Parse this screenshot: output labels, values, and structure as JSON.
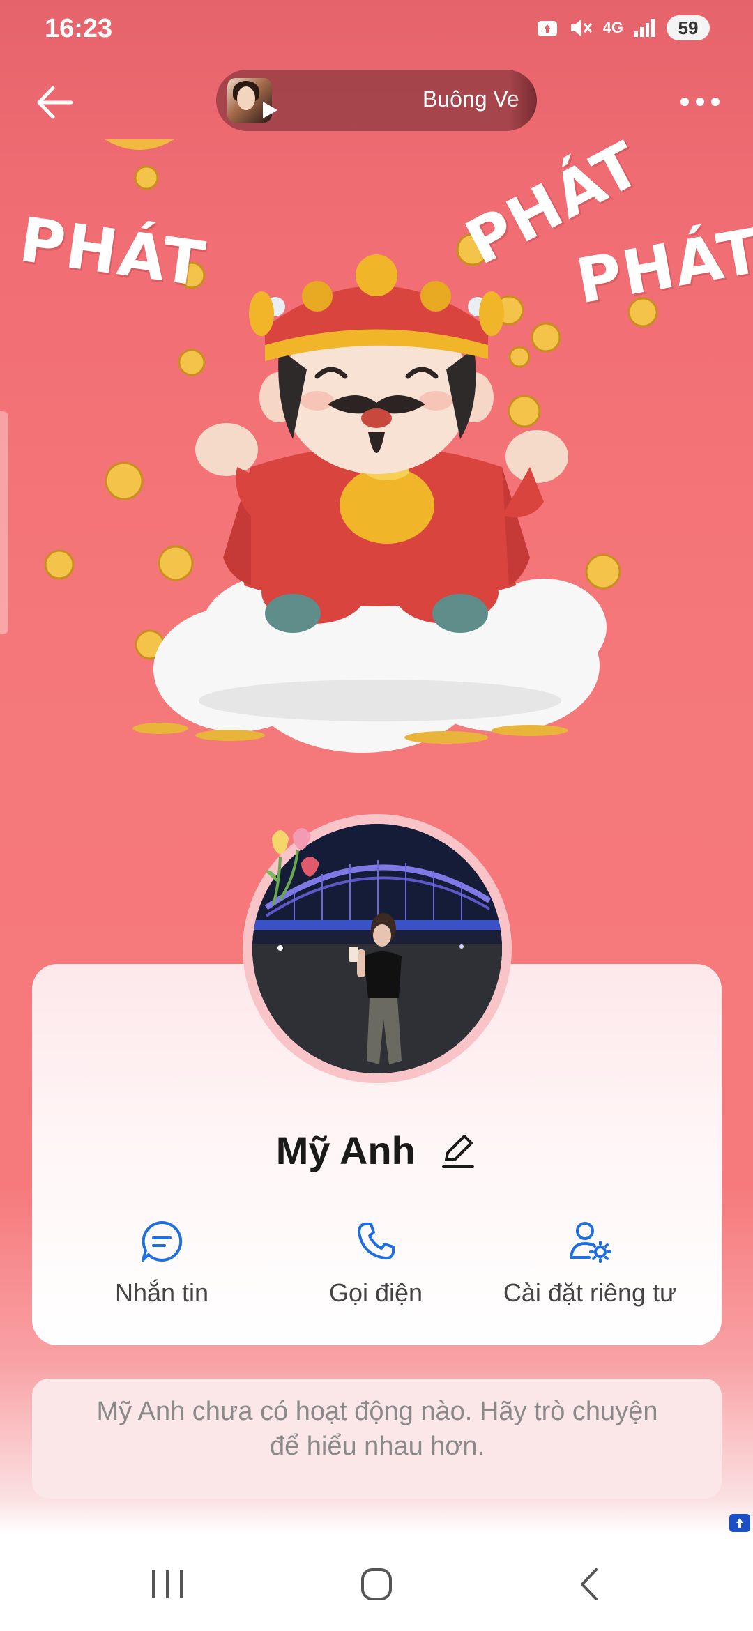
{
  "status_bar": {
    "time": "16:23",
    "network": "4G",
    "battery": "59"
  },
  "header": {
    "back_icon": "arrow-left-icon",
    "more_icon": "more-horizontal-icon",
    "music_title": "Buông Ve"
  },
  "cover": {
    "words": [
      "PHÁT",
      "PHÁT",
      "PHÁT"
    ]
  },
  "profile": {
    "name": "Mỹ Anh",
    "actions": [
      {
        "label": "Nhắn tin",
        "icon": "message-icon"
      },
      {
        "label": "Gọi điện",
        "icon": "phone-icon"
      },
      {
        "label": "Cài đặt riêng tư",
        "icon": "user-settings-icon"
      }
    ]
  },
  "activity": {
    "message": "Mỹ Anh chưa có hoạt động nào. Hãy trò chuyện để hiểu nhau hơn."
  },
  "colors": {
    "accent": "#1e6fe0",
    "background": "#f67478",
    "card": "#fff5f6",
    "activity_box": "#fbe6e8"
  },
  "navbar": {
    "icons": [
      "recent-apps-icon",
      "home-icon",
      "back-icon"
    ]
  }
}
